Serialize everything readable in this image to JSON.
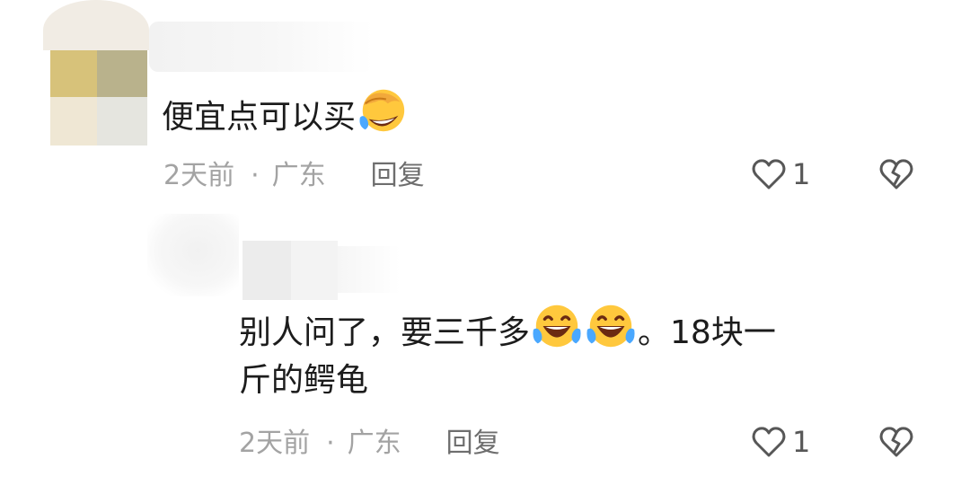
{
  "comment": {
    "text": "便宜点可以买",
    "emoji_icon": "grinning-cover-face-emoji",
    "time": "2天前",
    "separator": "·",
    "location": "广东",
    "reply_label": "回复",
    "like_count": "1"
  },
  "reply": {
    "line1_text": "别人问了，要三千多",
    "emoji_icon": "tears-of-joy-emoji",
    "line1_tail": "。18块一",
    "line2_text": "斤的鳄龟",
    "time": "2天前",
    "separator": "·",
    "location": "广东",
    "reply_label": "回复",
    "like_count": "1"
  },
  "colors": {
    "text": "#1c1c1c",
    "meta": "#a3a3a3",
    "reply_button": "#6e6e6e",
    "icon": "#575757",
    "emoji_yellow": "#ffc83d"
  }
}
